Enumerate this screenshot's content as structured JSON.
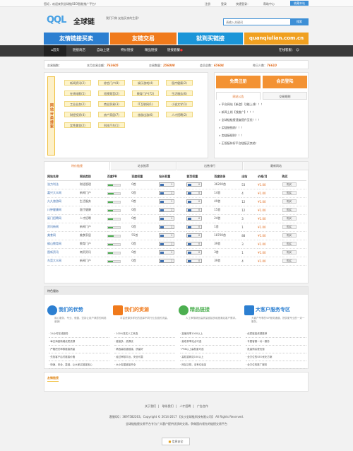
{
  "topbar": {
    "welcome": "您好，欢迎来到全球链SEO智能推广平台！",
    "login": "登录",
    "register_link": "注册",
    "quick_login": "快捷登录：",
    "help": "帮助中心",
    "favorite": "收藏本站"
  },
  "header": {
    "logo_q": "QQL",
    "logo_cn": "全球链",
    "slogan": "我们只做 友链买卖的生意！",
    "search_placeholder": "请输入关键词",
    "search_btn": "搜索"
  },
  "banners": [
    {
      "label": "友情链接买卖",
      "color": "#2c7fd1"
    },
    {
      "label": "友链交易",
      "color": "#f07a1b"
    },
    {
      "label": "就到买链接",
      "color": "#1a95d8"
    },
    {
      "label": "quanqiulian.com.cn",
      "color": "#f0a020"
    }
  ],
  "nav": {
    "items": [
      "首页",
      "链接商店",
      "自动上链",
      "特价链接",
      "精品链接",
      "链接套餐"
    ],
    "online": "在线客服："
  },
  "stats": {
    "l1": "交易指数：",
    "l2": "本月交易总额：",
    "v2": "763605",
    "l3": "交易数量：",
    "v3": "256008",
    "l4": "会员总数：",
    "v4": "65604",
    "l5": "昨日人数：",
    "v5": "76610"
  },
  "categories": {
    "label": "网站分类搜索",
    "items": [
      "新闻资讯(2)",
      "综合门户(8)",
      "娱乐游戏(4)",
      "医疗健康(2)",
      "在线电影(5)",
      "短视频音(2)",
      "教育门户(72)",
      "生活服务(6)",
      "工业业务(2)",
      "商业贸易(3)",
      "IT互联网(1)",
      "小说文学(1)",
      "财经投资(4)",
      "房产家居(7)",
      "旅游出游(6)",
      "人才招聘(2)",
      "女性美妆(2)",
      "科技汽车(1)"
    ]
  },
  "side": {
    "btn1": "免费注册",
    "btn2": "会员登陆",
    "tab1": "网站公告",
    "tab2": "交易规则",
    "news": [
      "平台网站【新会】功能上线！！！",
      "新闻上线【找推广】！！！",
      "全球链链接速度提升至优！！！",
      "买链接指南！！！",
      "卖链接规则！！！",
      "正规接待好平台链接买卖结！"
    ]
  },
  "main": {
    "tabs": [
      "特价链接",
      "站长推荐",
      "出售排行",
      "最新网站"
    ],
    "headers": [
      "网站名称",
      "网站类别",
      "百度PR",
      "百度权重",
      "站长权重",
      "首页权重",
      "百度收录",
      "出站",
      "价格/月",
      "购买"
    ],
    "rows": [
      {
        "name": "张力利法",
        "cat": "财经管理",
        "pr": 0.4,
        "bd": "0首",
        "zz": "1",
        "sy": "0",
        "sl": "36200首",
        "out": "53",
        "price": "¥1.00"
      },
      {
        "name": "嘉兴大众网",
        "cat": "新闻门户",
        "pr": 0.45,
        "bd": "0首",
        "zz": "1",
        "sy": "0",
        "sl": "14首",
        "out": "4",
        "price": "¥1.00"
      },
      {
        "name": "久久旅游网",
        "cat": "生活服务",
        "pr": 0.4,
        "bd": "0首",
        "zz": "1",
        "sy": "0",
        "sl": "49首",
        "out": "12",
        "price": "¥1.00"
      },
      {
        "name": "川钟健康网",
        "cat": "医疗健康",
        "pr": 0.4,
        "bd": "0首",
        "zz": "1",
        "sy": "0",
        "sl": "15首",
        "out": "12",
        "price": "¥1.00"
      },
      {
        "name": "厦门招聘网",
        "cat": "人才招聘",
        "pr": 0.4,
        "bd": "0首",
        "zz": "1",
        "sy": "0",
        "sl": "24首",
        "out": "3",
        "price": "¥1.00"
      },
      {
        "name": "资讯新闻",
        "cat": "新闻门户",
        "pr": 0.4,
        "bd": "0首",
        "zz": "1",
        "sy": "0",
        "sl": "1首",
        "out": "1",
        "price": "¥1.00"
      },
      {
        "name": "美食网",
        "cat": "美食家居",
        "pr": 0.45,
        "bd": "55首",
        "zz": "1",
        "sy": "0",
        "sl": "18700首",
        "out": "88",
        "price": "¥1.00"
      },
      {
        "name": "佛山教育网",
        "cat": "教育门户",
        "pr": 0.4,
        "bd": "0首",
        "zz": "1",
        "sy": "0",
        "sl": "39首",
        "out": "3",
        "price": "¥1.00"
      },
      {
        "name": "图新资讯",
        "cat": "商贸资讯",
        "pr": 0.4,
        "bd": "0首",
        "zz": "1",
        "sy": "0",
        "sl": "3首",
        "out": "1",
        "price": "¥1.00"
      },
      {
        "name": "东莞大众网",
        "cat": "新闻门户",
        "pr": 0.4,
        "bd": "0首",
        "zz": "1",
        "sy": "0",
        "sl": "39首",
        "out": "4",
        "price": "¥1.00"
      }
    ],
    "buy_label": "购买"
  },
  "service": {
    "title": "特色服务",
    "cards": [
      {
        "title": "我们的优势",
        "color": "#2c7fd1",
        "desc": "用心服务、专业、便捷，坚持让用户满意的网络营销！",
        "items": [
          "24小时在线服务",
          "每日海量新增优质资源",
          "严格把关审核链接质量",
          "先找客户后付链接价格",
          "快速、安全、靠谱，让大家买链接放心"
        ]
      },
      {
        "title": "我们的资源",
        "color": "#f07a1b",
        "desc": "丰富资源多样化的选择不同行业友链的流量。",
        "items": [
          "100%真实人工来选",
          "链接多，资源优",
          "精选高权重链接，质量好",
          "经过审核平台，安全可靠",
          "大小权重链接齐全"
        ]
      },
      {
        "title": "精品链接",
        "color": "#4caf50",
        "desc": "人工审核精品高质量链接多维度满足客户需求。",
        "items": [
          "高使用率1000以上",
          "高收录率站点可选",
          "PR6以上高权重可选",
          "高权重网站100以上",
          "网站正规，没有垃圾站"
        ]
      },
      {
        "title": "大客户服务专区",
        "color": "#2c7fd1",
        "desc": "大客户专享的VIP服务通道，提供更专业的一对一服务。",
        "items": [
          "优质链接资源推荐",
          "专属客服一对一服务",
          "批量购买更优惠",
          "全方位的SEO优化方案",
          "全方位的推广服务"
        ]
      }
    ]
  },
  "flinks": {
    "title": "友情链接"
  },
  "footer": {
    "links": [
      "关于我们",
      "联系我们",
      "人才招聘",
      "广告合作"
    ],
    "copyright": "客服QQ：3697582263，Copyright © 2014-2017 【长沙全球链科技有限公司】 All Rights Reserved.",
    "disclaimer": "全球链链接交易平台专为广大客户提供优质的交易，争做国内领先的链接交易平台",
    "badge": "信息安全"
  }
}
